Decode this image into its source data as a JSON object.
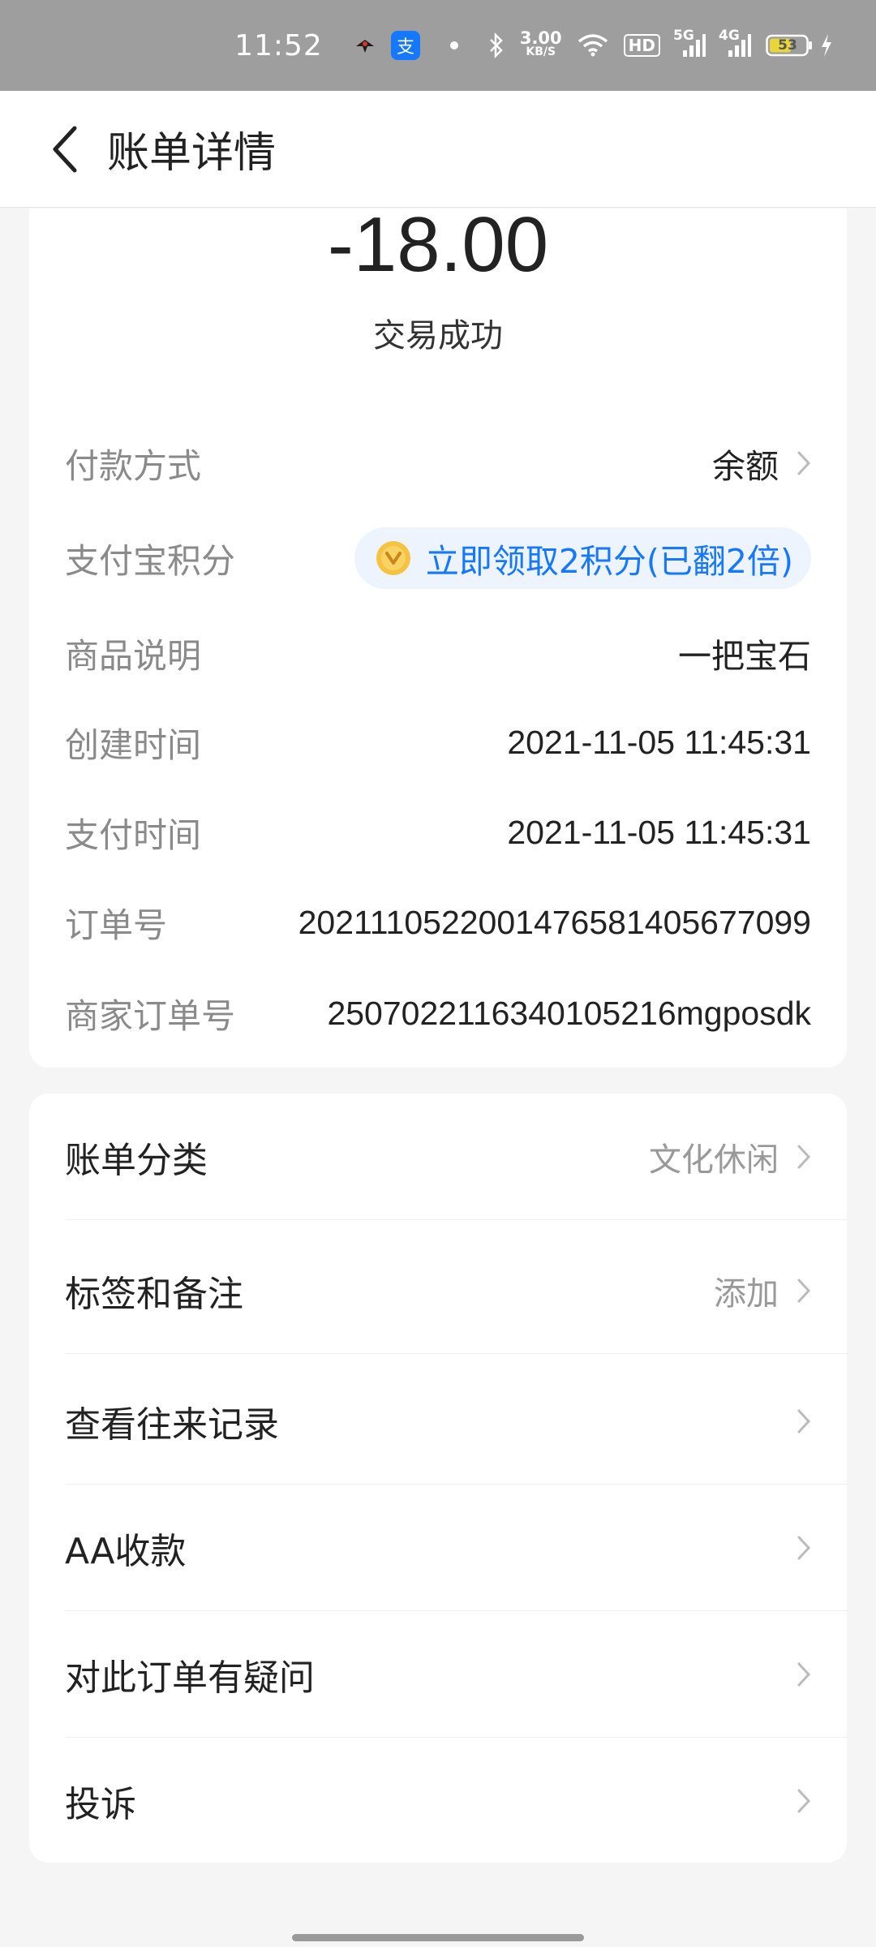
{
  "status_bar": {
    "time": "11:52",
    "net_speed_value": "3.00",
    "net_speed_unit": "KB/S",
    "hd_label": "HD",
    "sig1_label": "5G",
    "sig2_label": "4G",
    "battery": "53"
  },
  "header": {
    "title": "账单详情"
  },
  "summary": {
    "amount": "-18.00",
    "status": "交易成功"
  },
  "details": {
    "payment_method_label": "付款方式",
    "payment_method_value": "余额",
    "points_label": "支付宝积分",
    "points_value": "立即领取2积分(已翻2倍)",
    "product_label": "商品说明",
    "product_value": "一把宝石",
    "created_label": "创建时间",
    "created_value": "2021-11-05 11:45:31",
    "paid_label": "支付时间",
    "paid_value": "2021-11-05 11:45:31",
    "order_no_label": "订单号",
    "order_no_value": "2021110522001476581405677099",
    "merchant_order_label": "商家订单号",
    "merchant_order_value": "2507022116340105216mgposdk"
  },
  "menu": {
    "category_label": "账单分类",
    "category_value": "文化休闲",
    "tags_label": "标签和备注",
    "tags_value": "添加",
    "history_label": "查看往来记录",
    "aa_label": "AA收款",
    "question_label": "对此订单有疑问",
    "complaint_label": "投诉"
  },
  "colors": {
    "accent": "#1677ff",
    "status_bar": "#9e9e9e",
    "background": "#f5f5f5"
  }
}
